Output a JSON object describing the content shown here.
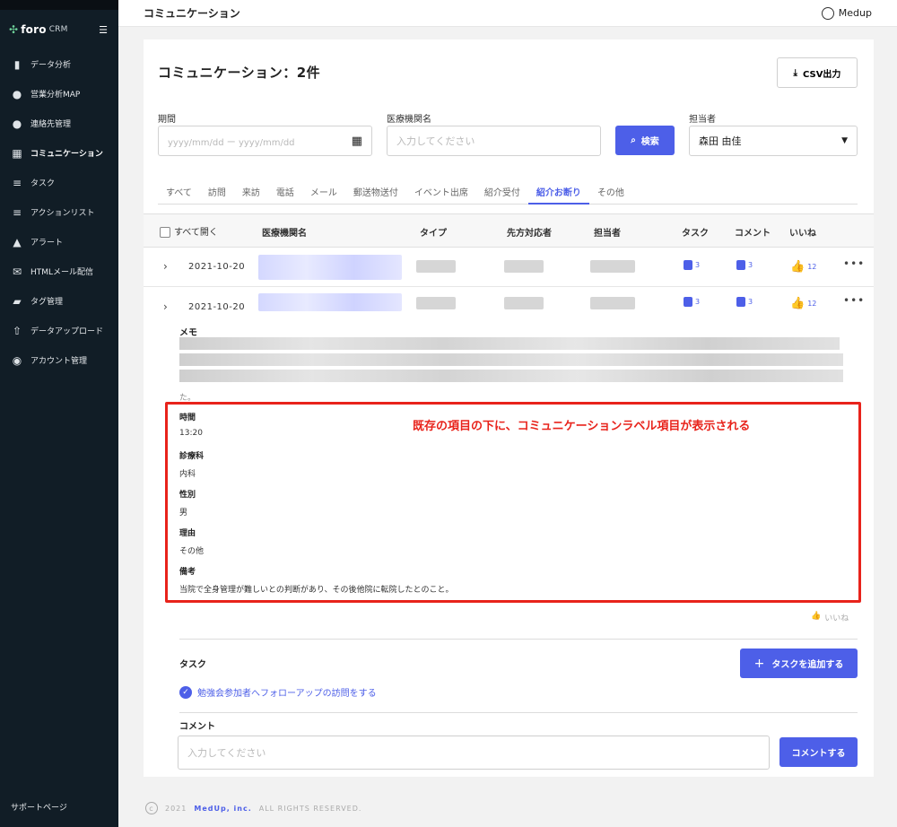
{
  "brand": {
    "name": "foro",
    "suffix": "CRM"
  },
  "sidebar": {
    "items": [
      {
        "label": "データ分析",
        "icon": "bar-chart-icon"
      },
      {
        "label": "営業分析MAP",
        "icon": "map-pin-icon"
      },
      {
        "label": "連絡先管理",
        "icon": "people-icon"
      },
      {
        "label": "コミュニケーション",
        "icon": "calendar-icon"
      },
      {
        "label": "タスク",
        "icon": "list-icon"
      },
      {
        "label": "アクションリスト",
        "icon": "playlist-add-icon"
      },
      {
        "label": "アラート",
        "icon": "bell-icon"
      },
      {
        "label": "HTMLメール配信",
        "icon": "mail-icon"
      },
      {
        "label": "タグ管理",
        "icon": "tag-icon"
      },
      {
        "label": "データアップロード",
        "icon": "upload-icon"
      },
      {
        "label": "アカウント管理",
        "icon": "account-icon"
      }
    ],
    "support": "サポートページ"
  },
  "header": {
    "title": "コミュニケーション",
    "user": "Medup"
  },
  "page": {
    "title": "コミュニケーション：2件",
    "csv_button": "CSV出力"
  },
  "filters": {
    "period_label": "期間",
    "period_placeholder": "yyyy/mm/dd ー yyyy/mm/dd",
    "institution_label": "医療機関名",
    "institution_placeholder": "入力してください",
    "search_button": "検索",
    "assignee_label": "担当者",
    "assignee_value": "森田 由佳"
  },
  "tabs": [
    "すべて",
    "訪問",
    "来訪",
    "電話",
    "メール",
    "郵送物送付",
    "イベント出席",
    "紹介受付",
    "紹介お断り",
    "その他"
  ],
  "active_tab": "紹介お断り",
  "table": {
    "headers": {
      "open_all": "すべて開く",
      "institution": "医療機関名",
      "type": "タイプ",
      "contact": "先方対応者",
      "assignee": "担当者",
      "task": "タスク",
      "comment": "コメント",
      "like": "いいね"
    },
    "rows": [
      {
        "date": "2021-10-20",
        "tasks": "3",
        "comments": "3",
        "likes": "12"
      },
      {
        "date": "2021-10-20",
        "tasks": "3",
        "comments": "3",
        "likes": "12"
      }
    ]
  },
  "detail": {
    "memo_label": "メモ",
    "memo_tail": "た。",
    "annotation": "既存の項目の下に、コミュニケーションラベル項目が表示される",
    "fields": [
      {
        "label": "時間",
        "value": "13:20"
      },
      {
        "label": "診療科",
        "value": "内科"
      },
      {
        "label": "性別",
        "value": "男"
      },
      {
        "label": "理由",
        "value": "その他"
      },
      {
        "label": "備考",
        "value": "当院で全身管理が難しいとの判断があり、その後他院に転院したとのこと。"
      }
    ],
    "like_label": "いいね",
    "task_title": "タスク",
    "add_task_button": "タスクを追加する",
    "task_item": "勉強会参加者へフォローアップの訪問をする",
    "comment_title": "コメント",
    "comment_placeholder": "入力してください",
    "comment_button": "コメントする"
  },
  "footer": {
    "year": "2021",
    "company": "MedUp, inc.",
    "rights": "ALL RIGHTS RESERVED."
  },
  "colors": {
    "accent": "#4d5fe8",
    "sidebar": "#111d26",
    "annotation": "#e8231b"
  }
}
